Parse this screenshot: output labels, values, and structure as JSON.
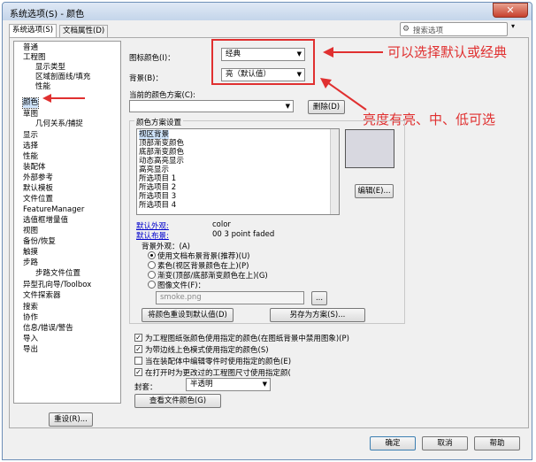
{
  "window": {
    "title": "系统选项(S) - 颜色",
    "close": "✕"
  },
  "tabs": [
    {
      "label": "系统选项(S)"
    },
    {
      "label": "文档属性(D)"
    }
  ],
  "search": {
    "placeholder": "搜索选项"
  },
  "tree": [
    "普通",
    "工程图",
    "显示类型",
    "区域剖面线/填充",
    "性能",
    "颜色",
    "草图",
    "几何关系/捕捉",
    "显示",
    "选择",
    "性能",
    "装配体",
    "外部参考",
    "默认模板",
    "文件位置",
    "FeatureManager",
    "选值框增量值",
    "视图",
    "备份/恢复",
    "触摸",
    "步路",
    "步路文件位置",
    "异型孔向导/Toolbox",
    "文件探索器",
    "搜索",
    "协作",
    "信息/错误/警告",
    "导入",
    "导出"
  ],
  "reset": "重设(R)...",
  "icon_color_label": "图标颜色(I)：",
  "icon_color_value": "经典",
  "background_label": "背景(B)：",
  "background_value": "亮（默认值）",
  "scheme_label": "当前的颜色方案(C):",
  "delete_btn": "删除(D)",
  "settings_group": "颜色方案设置",
  "list_items": [
    "视区背景",
    "顶部渐变颜色",
    "底部渐变颜色",
    "动态高亮显示",
    "高亮显示",
    "所选项目 1",
    "所选项目 2",
    "所选项目 3",
    "所选项目 4"
  ],
  "edit_btn": "编辑(E)...",
  "default_appearance_label": "默认外观:",
  "default_appearance_value": "color",
  "default_scene_label": "默认布景:",
  "default_scene_value": "00 3 point faded",
  "bg_appearance_label": "背景外观：(A)",
  "radio": [
    "使用文档布景背景(推荐)(U)",
    "素色(视区背景颜色在上)(P)",
    "渐变(顶部/底部渐变颜色在上)(G)",
    "图像文件(F)："
  ],
  "image_file": "smoke.png",
  "browse": "...",
  "reset_colors_btn": "将颜色重设到默认值(D)",
  "save_scheme_btn": "另存为方案(S)...",
  "checks": [
    {
      "label": "为工程图纸张颜色使用指定的颜色(在图纸背景中禁用图象)(P)",
      "checked": true
    },
    {
      "label": "为带边线上色模式使用指定的颜色(S)",
      "checked": true
    },
    {
      "label": "当在装配体中编辑零件时使用指定的颜色(E)",
      "checked": false
    },
    {
      "label": "在打开时为更改过的工程图尺寸使用指定颜(",
      "checked": true
    }
  ],
  "envelope_label": "封套：",
  "envelope_value": "半透明",
  "doc_colors_btn": "查看文件颜色(G)",
  "ok": "确定",
  "cancel": "取消",
  "help": "帮助",
  "annotations": {
    "a1": "可以选择默认或经典",
    "a2": "亮度有亮、中、低可选"
  },
  "colors": {
    "accent": "#e03030"
  }
}
